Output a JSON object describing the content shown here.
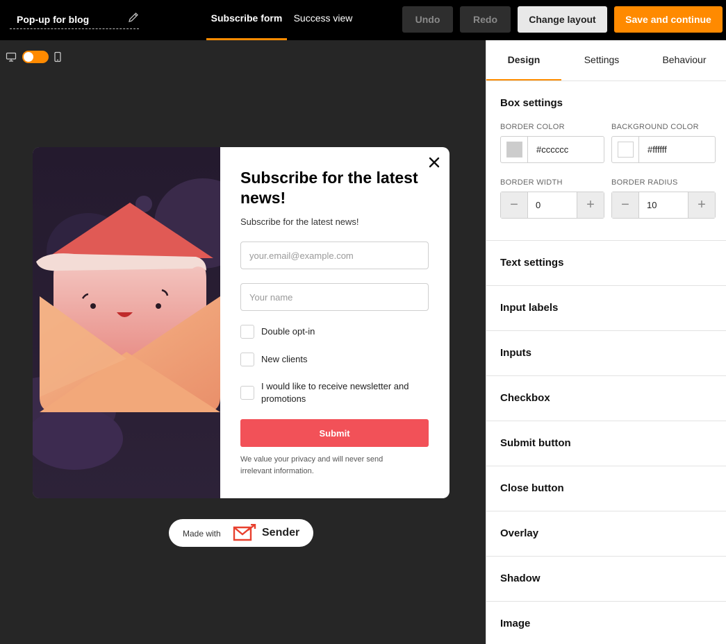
{
  "header": {
    "title": "Pop-up for blog",
    "tabs": [
      {
        "label": "Subscribe form",
        "active": true
      },
      {
        "label": "Success view",
        "active": false
      }
    ],
    "undo_label": "Undo",
    "redo_label": "Redo",
    "change_layout_label": "Change layout",
    "save_label": "Save and continue"
  },
  "preview": {
    "desktop_icon": "desktop-icon",
    "mobile_icon": "mobile-icon",
    "toggle_on": true
  },
  "popup": {
    "title": "Subscribe for the latest news!",
    "subtitle": "Subscribe for the latest news!",
    "email_placeholder": "your.email@example.com",
    "name_placeholder": "Your name",
    "checkboxes": [
      {
        "label": "Double opt-in"
      },
      {
        "label": "New clients"
      },
      {
        "label": "I would like to receive newsletter and promotions"
      }
    ],
    "submit_label": "Submit",
    "privacy_text": "We value your privacy and will never send irrelevant information."
  },
  "branding": {
    "made_with": "Made with",
    "brand": "Sender"
  },
  "panel": {
    "tabs": [
      {
        "label": "Design",
        "active": true
      },
      {
        "label": "Settings",
        "active": false
      },
      {
        "label": "Behaviour",
        "active": false
      }
    ],
    "box_settings": {
      "title": "Box settings",
      "border_color_label": "BORDER COLOR",
      "border_color": "#cccccc",
      "background_color_label": "BACKGROUND COLOR",
      "background_color": "#ffffff",
      "border_width_label": "BORDER WIDTH",
      "border_width": "0",
      "border_radius_label": "BORDER RADIUS",
      "border_radius": "10"
    },
    "sections": [
      {
        "label": "Text settings"
      },
      {
        "label": "Input labels"
      },
      {
        "label": "Inputs"
      },
      {
        "label": "Checkbox"
      },
      {
        "label": "Submit button"
      },
      {
        "label": "Close button"
      },
      {
        "label": "Overlay"
      },
      {
        "label": "Shadow"
      },
      {
        "label": "Image"
      }
    ]
  },
  "colors": {
    "accent": "#ff8a00",
    "submit": "#f25158"
  }
}
